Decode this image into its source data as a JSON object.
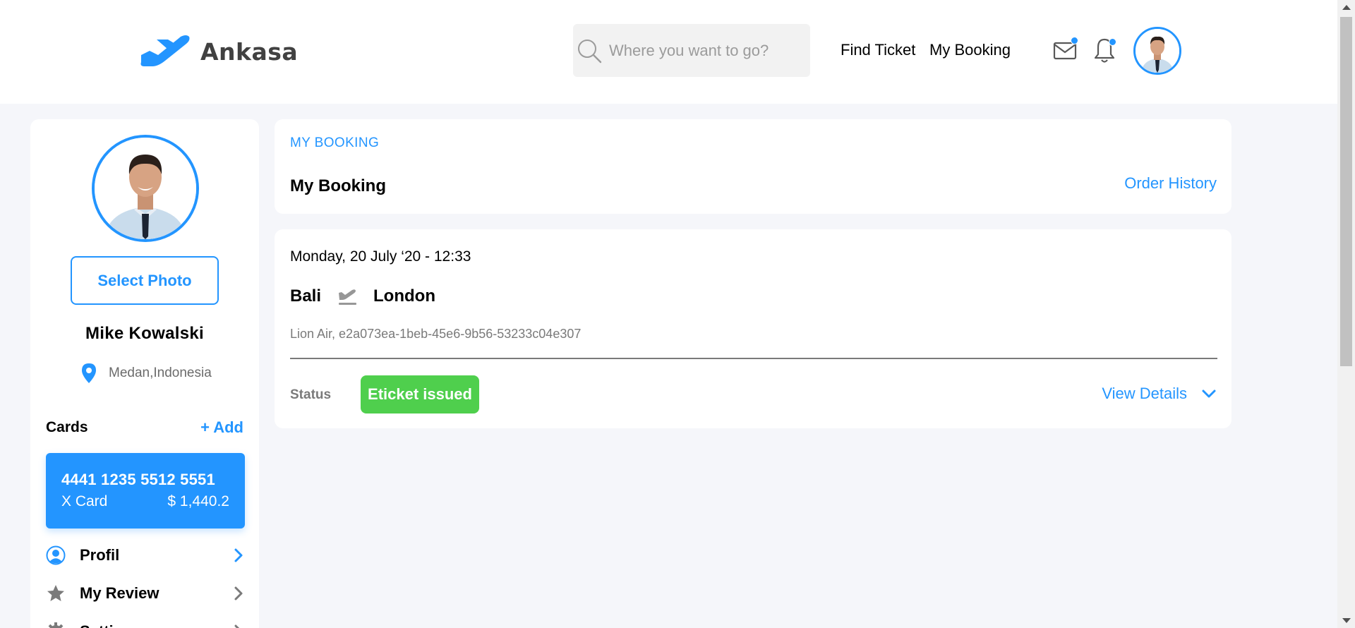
{
  "header": {
    "brand": "Ankasa",
    "search_placeholder": "Where you want to go?",
    "nav": {
      "find_ticket": "Find Ticket",
      "my_booking": "My Booking"
    },
    "icons": [
      "plane-logo-icon",
      "search-icon",
      "mail-icon",
      "bell-icon",
      "avatar"
    ],
    "accent": "#2395ff"
  },
  "sidebar": {
    "select_photo": "Select Photo",
    "name": "Mike Kowalski",
    "location": "Medan,Indonesia",
    "cards_title": "Cards",
    "add_label": "+ Add",
    "card": {
      "number": "4441 1235 5512 5551",
      "type": "X Card",
      "balance": "$ 1,440.2"
    },
    "menu": [
      {
        "label": "Profil",
        "icon": "user-circle-icon",
        "active": true
      },
      {
        "label": "My Review",
        "icon": "star-icon",
        "active": false
      },
      {
        "label": "Settings",
        "icon": "gear-icon",
        "active": false
      }
    ]
  },
  "main": {
    "section_label": "MY BOOKING",
    "title": "My Booking",
    "order_history": "Order History",
    "booking": {
      "date": "Monday, 20 July ‘20 - 12:33",
      "from": "Bali",
      "to": "London",
      "meta": "Lion Air, e2a073ea-1beb-45e6-9b56-53233c04e307",
      "status_label": "Status",
      "status": "Eticket issued",
      "status_color": "#4fcf4d",
      "view_details": "View Details"
    }
  }
}
